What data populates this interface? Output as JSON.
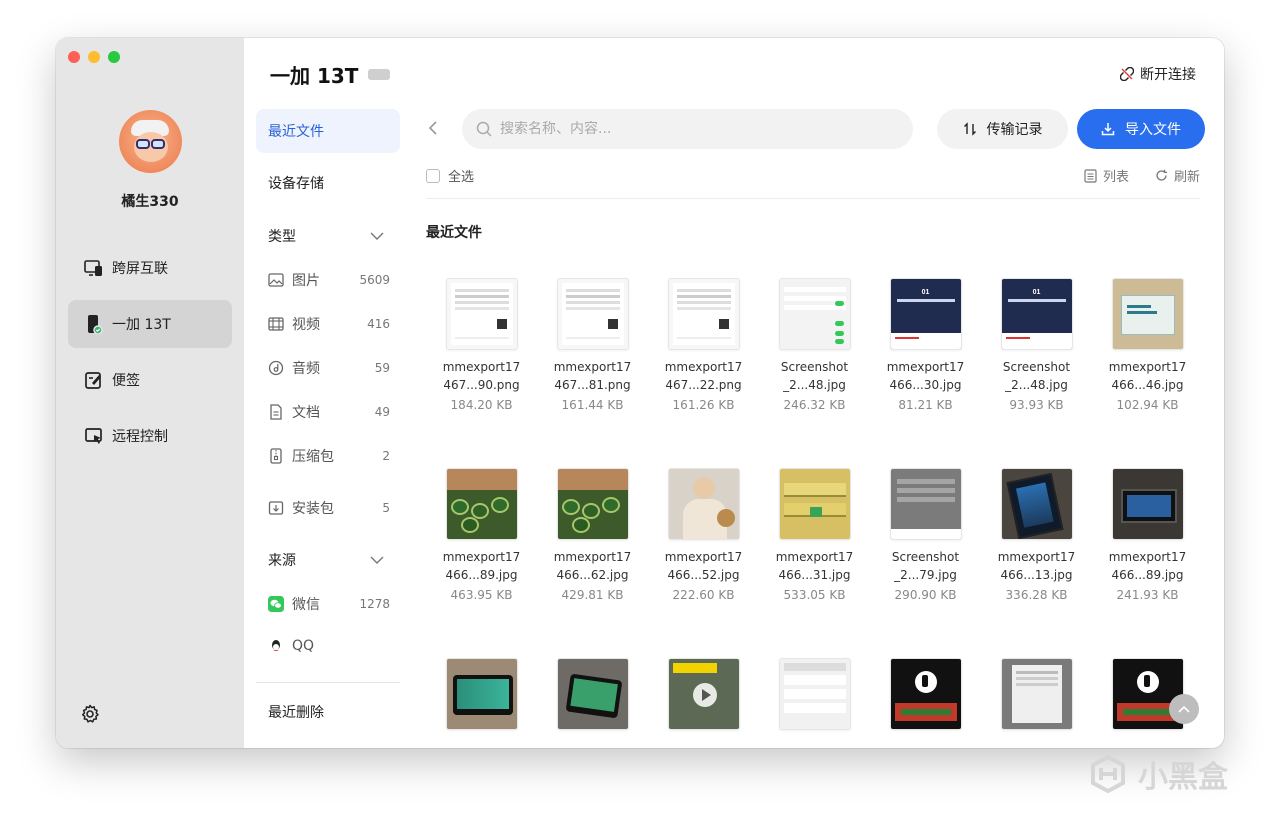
{
  "window": {
    "device_name": "一加 13T",
    "disconnect_label": "断开连接"
  },
  "sidebar": {
    "username": "橘生330",
    "items": [
      {
        "label": "跨屏互联",
        "icon": "screen-link-icon"
      },
      {
        "label": "一加 13T",
        "icon": "phone-icon",
        "active": true
      },
      {
        "label": "便签",
        "icon": "note-icon"
      },
      {
        "label": "远程控制",
        "icon": "remote-control-icon"
      }
    ],
    "settings_icon": "gear-icon"
  },
  "categories": {
    "recent": "最近文件",
    "storage": "设备存储",
    "type_header": "类型",
    "types": [
      {
        "label": "图片",
        "count": "5609",
        "icon": "image-icon"
      },
      {
        "label": "视频",
        "count": "416",
        "icon": "video-icon"
      },
      {
        "label": "音频",
        "count": "59",
        "icon": "audio-icon"
      },
      {
        "label": "文档",
        "count": "49",
        "icon": "document-icon"
      },
      {
        "label": "压缩包",
        "count": "2",
        "icon": "archive-icon"
      },
      {
        "label": "安装包",
        "count": "5",
        "icon": "install-package-icon"
      }
    ],
    "source_header": "来源",
    "sources": [
      {
        "label": "微信",
        "count": "1278",
        "icon": "wechat-icon"
      },
      {
        "label": "QQ",
        "count": "",
        "icon": "qq-icon"
      }
    ],
    "recently_deleted": "最近删除"
  },
  "toolbar": {
    "search_placeholder": "搜索名称、内容...",
    "transfer_label": "传输记录",
    "import_label": "导入文件",
    "select_all": "全选",
    "list_label": "列表",
    "refresh_label": "刷新"
  },
  "section_title": "最近文件",
  "files": [
    {
      "name1": "mmexport17",
      "name2": "467...90.png",
      "size": "184.20 KB",
      "thumb": "doc"
    },
    {
      "name1": "mmexport17",
      "name2": "467...81.png",
      "size": "161.44 KB",
      "thumb": "doc"
    },
    {
      "name1": "mmexport17",
      "name2": "467...22.png",
      "size": "161.26 KB",
      "thumb": "doc"
    },
    {
      "name1": "Screenshot",
      "name2": "_2...48.jpg",
      "size": "246.32 KB",
      "thumb": "settings"
    },
    {
      "name1": "mmexport17",
      "name2": "466...30.jpg",
      "size": "81.21 KB",
      "thumb": "slide"
    },
    {
      "name1": "Screenshot",
      "name2": "_2...48.jpg",
      "size": "93.93 KB",
      "thumb": "slide"
    },
    {
      "name1": "mmexport17",
      "name2": "466...46.jpg",
      "size": "102.94 KB",
      "thumb": "box"
    },
    {
      "name1": "mmexport17",
      "name2": "466...89.jpg",
      "size": "463.95 KB",
      "thumb": "market"
    },
    {
      "name1": "mmexport17",
      "name2": "466...62.jpg",
      "size": "429.81 KB",
      "thumb": "market"
    },
    {
      "name1": "mmexport17",
      "name2": "466...52.jpg",
      "size": "222.60 KB",
      "thumb": "person"
    },
    {
      "name1": "mmexport17",
      "name2": "466...31.jpg",
      "size": "533.05 KB",
      "thumb": "shelf"
    },
    {
      "name1": "Screenshot",
      "name2": "_2...79.jpg",
      "size": "290.90 KB",
      "thumb": "graymenu"
    },
    {
      "name1": "mmexport17",
      "name2": "466...13.jpg",
      "size": "336.28 KB",
      "thumb": "tablet"
    },
    {
      "name1": "mmexport17",
      "name2": "466...89.jpg",
      "size": "241.93 KB",
      "thumb": "keyboard"
    },
    {
      "name1": "",
      "name2": "",
      "size": "",
      "thumb": "tablet2"
    },
    {
      "name1": "",
      "name2": "",
      "size": "",
      "thumb": "tablet3"
    },
    {
      "name1": "",
      "name2": "",
      "size": "",
      "thumb": "video"
    },
    {
      "name1": "",
      "name2": "",
      "size": "",
      "thumb": "settings2"
    },
    {
      "name1": "",
      "name2": "",
      "size": "",
      "thumb": "tiktok"
    },
    {
      "name1": "",
      "name2": "",
      "size": "",
      "thumb": "graydoc"
    },
    {
      "name1": "",
      "name2": "",
      "size": "",
      "thumb": "tiktok"
    }
  ],
  "watermark": "小黑盒",
  "colors": {
    "accent": "#2a6ef0",
    "sidebar_bg": "#e6e6e6",
    "active_item_bg": "#eef3fd"
  }
}
